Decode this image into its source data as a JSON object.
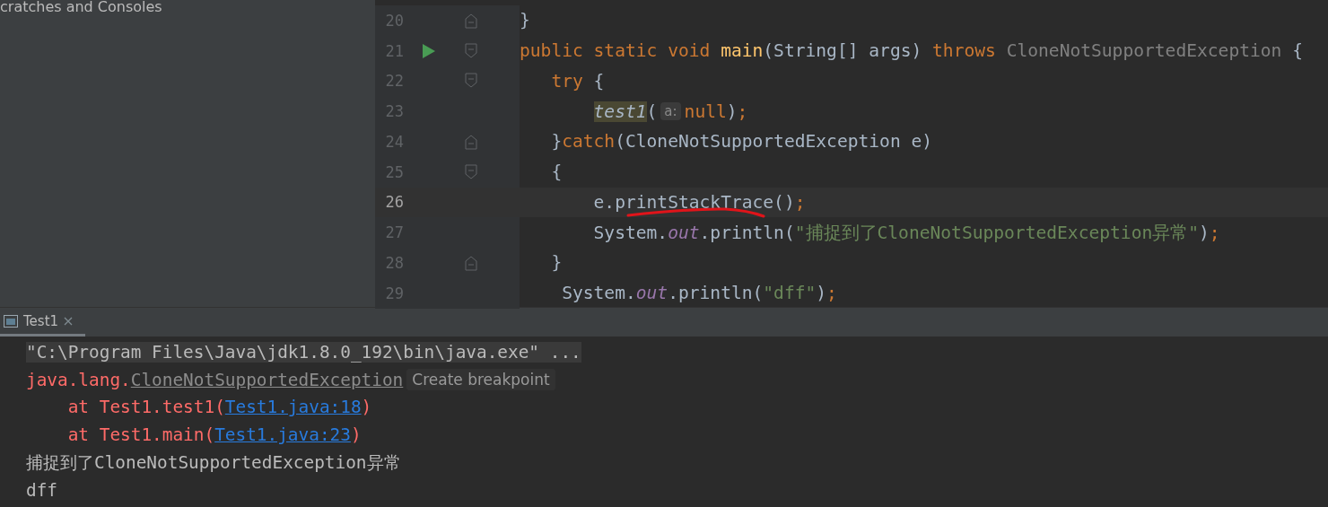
{
  "sidebar": {
    "title": "cratches and Consoles"
  },
  "editor": {
    "lines": [
      {
        "number": "20",
        "run_marker": false,
        "fold": {
          "kind": "end"
        },
        "current": false,
        "tokens": [
          {
            "kind": "plain",
            "text": "}"
          }
        ]
      },
      {
        "number": "21",
        "run_marker": true,
        "fold": {
          "kind": "start"
        },
        "current": false,
        "tokens": [
          {
            "kind": "keyword",
            "text": "public static void "
          },
          {
            "kind": "method",
            "text": "main"
          },
          {
            "kind": "plain",
            "text": "(String[] args) "
          },
          {
            "kind": "keyword",
            "text": "throws "
          },
          {
            "kind": "muted",
            "text": "CloneNotSupportedException"
          },
          {
            "kind": "plain",
            "text": " {"
          }
        ]
      },
      {
        "number": "22",
        "run_marker": false,
        "fold": {
          "kind": "start"
        },
        "current": false,
        "tokens": [
          {
            "kind": "keyword",
            "text": "   try"
          },
          {
            "kind": "plain",
            "text": " {"
          }
        ]
      },
      {
        "number": "23",
        "run_marker": false,
        "current": false,
        "tokens": [
          {
            "kind": "usage",
            "text": "       test1"
          },
          {
            "kind": "plain",
            "text": "("
          },
          {
            "kind": "hint",
            "text": "a:"
          },
          {
            "kind": "keyword",
            "text": "null"
          },
          {
            "kind": "plain",
            "text": ")"
          },
          {
            "kind": "keyword",
            "text": ";"
          }
        ]
      },
      {
        "number": "24",
        "run_marker": false,
        "fold": {
          "kind": "end"
        },
        "current": false,
        "tokens": [
          {
            "kind": "plain",
            "text": "   }"
          },
          {
            "kind": "keyword",
            "text": "catch"
          },
          {
            "kind": "plain",
            "text": "(CloneNotSupportedException e)"
          }
        ]
      },
      {
        "number": "25",
        "run_marker": false,
        "fold": {
          "kind": "start"
        },
        "current": false,
        "tokens": [
          {
            "kind": "plain",
            "text": "   {"
          }
        ]
      },
      {
        "number": "26",
        "run_marker": false,
        "current": true,
        "tokens": [
          {
            "kind": "plain",
            "text": "       e.printStackTrace()"
          },
          {
            "kind": "keyword",
            "text": ";"
          }
        ]
      },
      {
        "number": "27",
        "run_marker": false,
        "current": false,
        "tokens": [
          {
            "kind": "plain",
            "text": "       System."
          },
          {
            "kind": "field",
            "text": "out"
          },
          {
            "kind": "plain",
            "text": ".println("
          },
          {
            "kind": "string",
            "text": "\"捕捉到了CloneNotSupportedException异常\""
          },
          {
            "kind": "plain",
            "text": ")"
          },
          {
            "kind": "keyword",
            "text": ";"
          }
        ]
      },
      {
        "number": "28",
        "run_marker": false,
        "fold": {
          "kind": "end"
        },
        "current": false,
        "tokens": [
          {
            "kind": "plain",
            "text": "   }"
          }
        ]
      },
      {
        "number": "29",
        "run_marker": false,
        "current": false,
        "tokens": [
          {
            "kind": "plain",
            "text": "    System."
          },
          {
            "kind": "field",
            "text": "out"
          },
          {
            "kind": "plain",
            "text": ".println("
          },
          {
            "kind": "string",
            "text": "\"dff\""
          },
          {
            "kind": "plain",
            "text": ")"
          },
          {
            "kind": "keyword",
            "text": ";"
          }
        ]
      }
    ]
  },
  "console": {
    "tabs": [
      {
        "label": "Test1",
        "selected": true
      }
    ],
    "lines": [
      {
        "kind": "command",
        "segments": [
          {
            "kind": "plain",
            "text": "\"C:\\Program Files\\Java\\jdk1.8.0_192\\bin\\java.exe\" ..."
          }
        ]
      },
      {
        "kind": "output",
        "segments": [
          {
            "kind": "error",
            "text": "java.lang."
          },
          {
            "kind": "class-link",
            "text": "CloneNotSupportedException"
          },
          {
            "kind": "tooltip",
            "text": "Create breakpoint"
          }
        ]
      },
      {
        "kind": "output",
        "segments": [
          {
            "kind": "error",
            "text": "    at Test1.test1("
          },
          {
            "kind": "link",
            "text": "Test1.java:18"
          },
          {
            "kind": "error",
            "text": ")"
          }
        ]
      },
      {
        "kind": "output",
        "segments": [
          {
            "kind": "error",
            "text": "    at Test1.main("
          },
          {
            "kind": "link",
            "text": "Test1.java:23"
          },
          {
            "kind": "error",
            "text": ")"
          }
        ]
      },
      {
        "kind": "output",
        "segments": [
          {
            "kind": "plain",
            "text": "捕捉到了CloneNotSupportedException异常"
          }
        ]
      },
      {
        "kind": "output",
        "segments": [
          {
            "kind": "plain",
            "text": "dff"
          }
        ]
      }
    ]
  }
}
